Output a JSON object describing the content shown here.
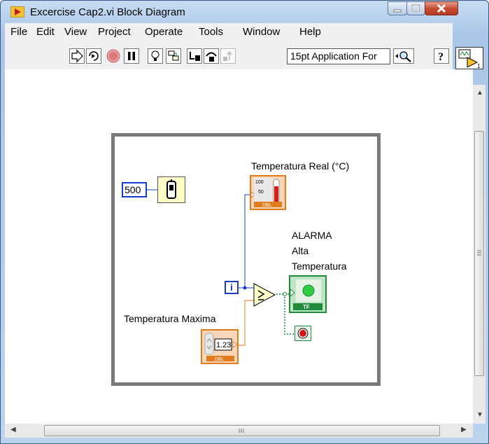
{
  "window": {
    "title": "Excercise Cap2.vi Block Diagram"
  },
  "menu": [
    "File",
    "Edit",
    "View",
    "Project",
    "Operate",
    "Tools",
    "Window",
    "Help"
  ],
  "toolbar": {
    "icons": [
      "run-arrow-icon",
      "run-continuously-icon",
      "abort-icon",
      "pause-icon",
      "highlight-execution-icon",
      "retain-wire-values-icon",
      "step-into-icon",
      "step-over-icon",
      "step-out-icon",
      "search-icon",
      "help-icon"
    ],
    "font_label": "15pt Application For"
  },
  "diagram": {
    "wait_constant": "500",
    "iteration_terminal": "i",
    "thermometer_label": "Temperatura Real (°C)",
    "thermometer_scale_high": "100",
    "thermometer_scale_mid": "50",
    "thermometer_type": "DBL",
    "alarm_label_line1": "ALARMA",
    "alarm_label_line2": "Alta",
    "alarm_label_line3": "Temperatura",
    "led_type": "TF",
    "numeric_label": "Temperatura Maxima",
    "numeric_value": "1.23",
    "numeric_type": "DBL"
  },
  "colors": {
    "loop_border": "#7a7a7a",
    "integer_wire": "#1a3ccc",
    "double_wire": "#e07b1e",
    "boolean_wire": "#1e8a3a"
  }
}
